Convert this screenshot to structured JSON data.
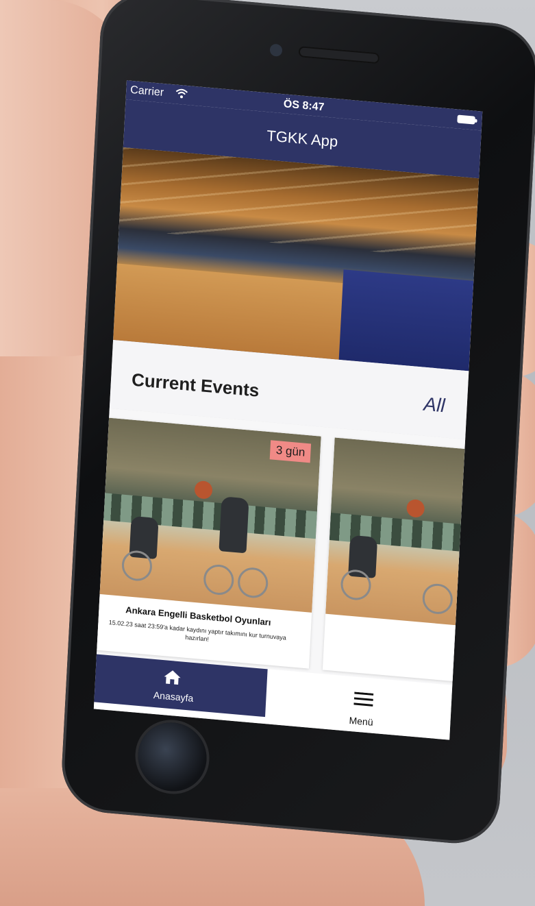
{
  "status_bar": {
    "carrier": "Carrier",
    "time": "ÖS 8:47"
  },
  "header": {
    "title": "TGKK App"
  },
  "section": {
    "title": "Current Events",
    "all_link": "All"
  },
  "events": [
    {
      "badge": "3 gün",
      "title": "Ankara Engelli Basketbol Oyunları",
      "description": "15.02.23 saat 23:59'a kadar kaydını yaptır takımını kur turnuvaya hazırlan!"
    },
    {
      "badge": "",
      "title": "",
      "description": ""
    }
  ],
  "tab_bar": {
    "home_label": "Anasayfa",
    "menu_label": "Menü"
  },
  "colors": {
    "primary": "#2e3466",
    "badge": "#f08a86"
  },
  "icons": [
    "wifi-icon",
    "battery-icon",
    "home-icon",
    "menu-icon"
  ]
}
